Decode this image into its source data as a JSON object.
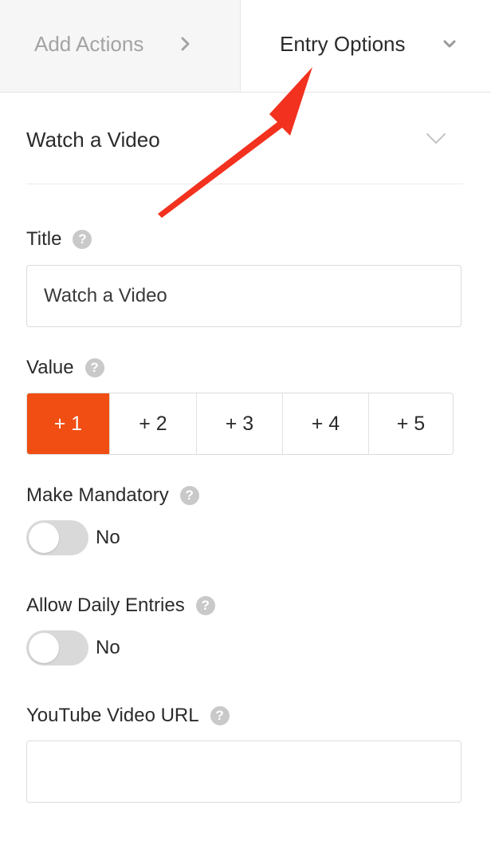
{
  "tabs": {
    "add_actions": "Add Actions",
    "entry_options": "Entry Options"
  },
  "section": {
    "title": "Watch a Video"
  },
  "fields": {
    "title_label": "Title",
    "title_value": "Watch a Video",
    "value_label": "Value",
    "value_options": [
      "+ 1",
      "+ 2",
      "+ 3",
      "+ 4",
      "+ 5"
    ],
    "value_selected": "+ 1",
    "mandatory_label": "Make Mandatory",
    "mandatory_state": "No",
    "daily_label": "Allow Daily Entries",
    "daily_state": "No",
    "youtube_label": "YouTube Video URL",
    "youtube_value": ""
  },
  "help_glyph": "?",
  "colors": {
    "accent": "#f04e12",
    "arrow": "#f2311f",
    "toggle_off": "#d9d9d9"
  },
  "icons": [
    "chevron-right-icon",
    "chevron-down-icon",
    "help-icon",
    "annotation-arrow"
  ]
}
